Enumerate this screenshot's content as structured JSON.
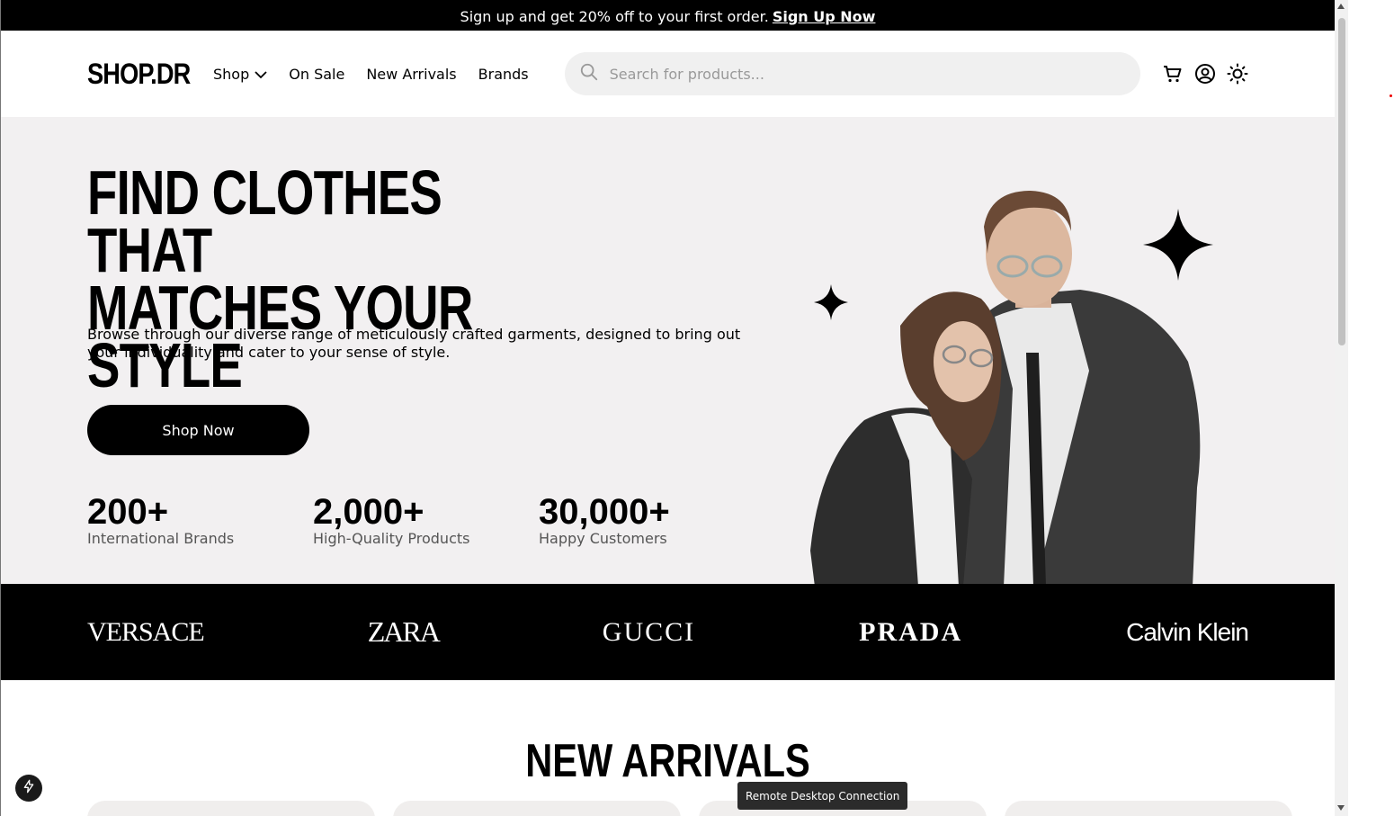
{
  "promo": {
    "text": "Sign up and get 20% off to your first order.",
    "link": "Sign Up Now"
  },
  "header": {
    "logo": "SHOP.DR",
    "nav": [
      "Shop",
      "On Sale",
      "New Arrivals",
      "Brands"
    ],
    "search_placeholder": "Search for products...",
    "icons": [
      "cart-icon",
      "user-icon",
      "sun-icon"
    ]
  },
  "hero": {
    "title_line1": "FIND CLOTHES THAT",
    "title_line2": "MATCHES YOUR STYLE",
    "description": "Browse through our diverse range of meticulously crafted garments, designed to bring out your individuality and cater to your sense of style.",
    "cta": "Shop Now",
    "stats": [
      {
        "value": "200+",
        "label": "International Brands"
      },
      {
        "value": "2,000+",
        "label": "High-Quality Products"
      },
      {
        "value": "30,000+",
        "label": "Happy Customers"
      }
    ]
  },
  "brands": [
    "VERSACE",
    "ZARA",
    "GUCCI",
    "PRADA",
    "Calvin Klein"
  ],
  "arrivals": {
    "title": "NEW ARRIVALS"
  },
  "tooltip": "Remote Desktop Connection",
  "colors": {
    "accent": "#000000",
    "hero_bg": "#f2f0f1",
    "search_bg": "#f0f0f0"
  }
}
